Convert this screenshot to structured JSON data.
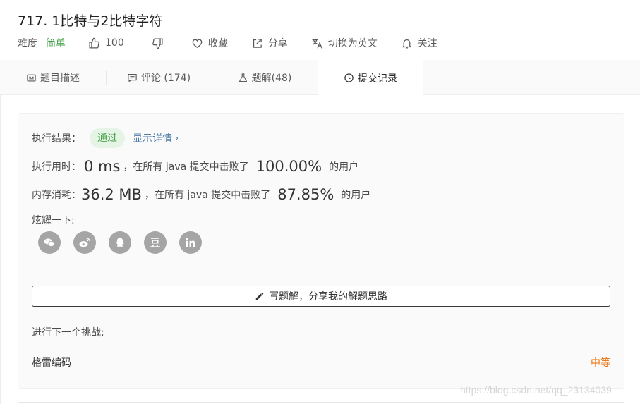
{
  "problem": {
    "title": "717. 1比特与2比特字符"
  },
  "meta": {
    "difficulty_label": "难度",
    "difficulty_value": "简单",
    "likes": "100",
    "favorite_label": "收藏",
    "share_label": "分享",
    "switch_lang_label": "切换为英文",
    "follow_label": "关注",
    "difficulty_color": "#43a047"
  },
  "tabs": [
    {
      "label": "题目描述",
      "icon": "description-icon"
    },
    {
      "label": "评论 (174)",
      "icon": "comment-icon"
    },
    {
      "label": "题解(48)",
      "icon": "flask-icon"
    },
    {
      "label": "提交记录",
      "icon": "clock-icon",
      "active": true
    }
  ],
  "result": {
    "result_label": "执行结果：",
    "status": "通过",
    "details_label": "显示详情",
    "runtime_label": "执行用时：",
    "runtime_value": "0 ms",
    "runtime_mid": "，在所有 java 提交中击败了",
    "runtime_percent": "100.00%",
    "runtime_tail": "的用户",
    "memory_label": "内存消耗：",
    "memory_value": "36.2 MB",
    "memory_mid": "，在所有 java 提交中击败了",
    "memory_percent": "87.85%",
    "memory_tail": "的用户",
    "share_label": "炫耀一下:",
    "social": [
      "wechat-icon",
      "weibo-icon",
      "qq-icon",
      "douban-icon",
      "linkedin-icon"
    ],
    "write_solution": "写题解，分享我的解题思路",
    "next_label": "进行下一个挑战:",
    "next_problem": "格雷编码",
    "next_level": "中等",
    "success_color": "#43a047",
    "medium_color": "#ef6c00"
  },
  "watermark": "https://blog.csdn.net/qq_23134039"
}
